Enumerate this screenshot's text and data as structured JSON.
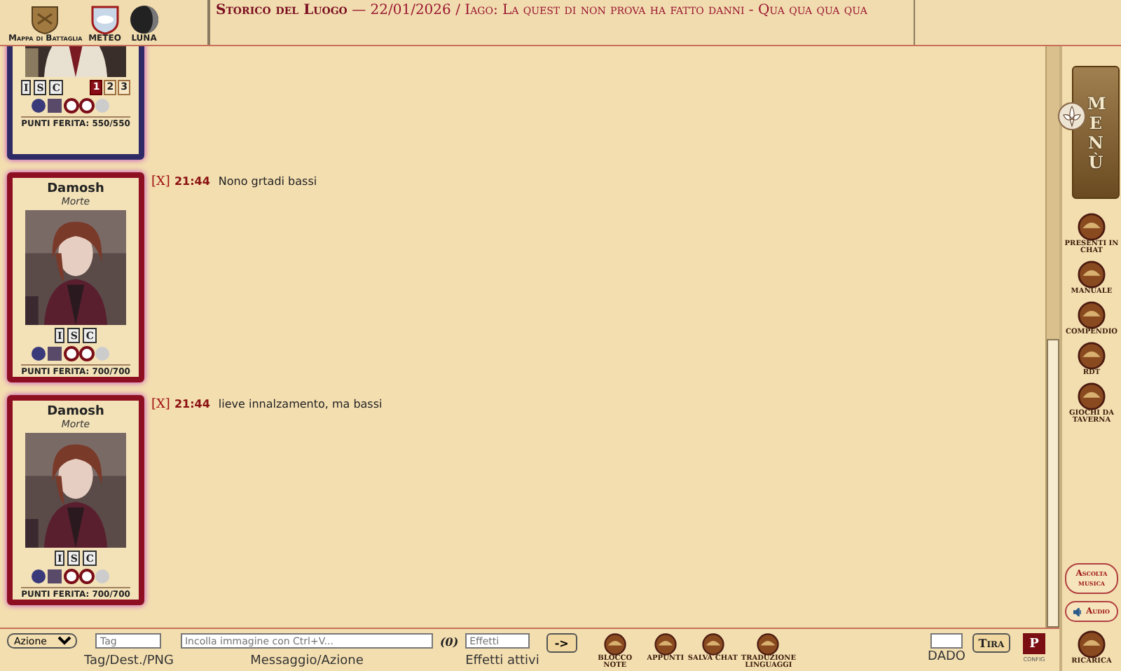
{
  "header": {
    "nav": [
      {
        "label": "Mappa di Battaglia",
        "kind": "shield"
      },
      {
        "label": "METEO",
        "kind": "weather"
      },
      {
        "label": "LUNA",
        "kind": "moon"
      }
    ],
    "log_title": "Storico del Luogo",
    "log_text": "— 22/01/2026 / Iago: La quest di non prova ha fatto danni - Qua qua qua qua"
  },
  "posts": [
    {
      "card": {
        "color": "#2e2a66",
        "badges": [
          "I",
          "S",
          "C"
        ],
        "numbers": [
          {
            "label": "1",
            "selected": true
          },
          {
            "label": "2",
            "selected": false
          },
          {
            "label": "3",
            "selected": false
          }
        ],
        "hit_points": "PUNTI FERITA: 550/550"
      }
    },
    {
      "card": {
        "name": "Damosh",
        "subtitle": "Morte",
        "color": "#8e0f22",
        "badges": [
          "I",
          "S",
          "C"
        ],
        "hit_points": "PUNTI FERITA: 700/700"
      },
      "message": {
        "close": "[X]",
        "time": "21:44",
        "text": "Nono grtadi bassi"
      }
    },
    {
      "card": {
        "name": "Damosh",
        "subtitle": "Morte",
        "color": "#8e0f22",
        "badges": [
          "I",
          "S",
          "C"
        ],
        "hit_points": "PUNTI FERITA: 700/700"
      },
      "message": {
        "close": "[X]",
        "time": "21:44",
        "text": "lieve innalzamento, ma bassi"
      }
    }
  ],
  "sidebar": {
    "menu": "MENÙ",
    "buttons": [
      "PRESENTI IN CHAT",
      "MANUALE",
      "COMPENDIO",
      "RDT",
      "GIOCHI DA TAVERNA"
    ],
    "music": "Ascolta musica",
    "audio": "Audio",
    "reload": "RICARICA"
  },
  "composer": {
    "mode": "Azione",
    "tag_placeholder": "Tag",
    "tag_label": "Tag/Dest./PNG",
    "message_placeholder": "Incolla immagine con Ctrl+V...",
    "message_label": "Messaggio/Azione",
    "count": "(0)",
    "effects_placeholder": "Effetti",
    "effects_label": "Effetti attivi",
    "send": "->",
    "tools": [
      "BLOCCO NOTE",
      "APPUNTI",
      "SALVA CHAT",
      "TRADUZIONE LINGUAGGI"
    ],
    "dice_label": "DADO",
    "roll": "Tira",
    "config_mark": "P",
    "config_label": "CONFIG"
  }
}
